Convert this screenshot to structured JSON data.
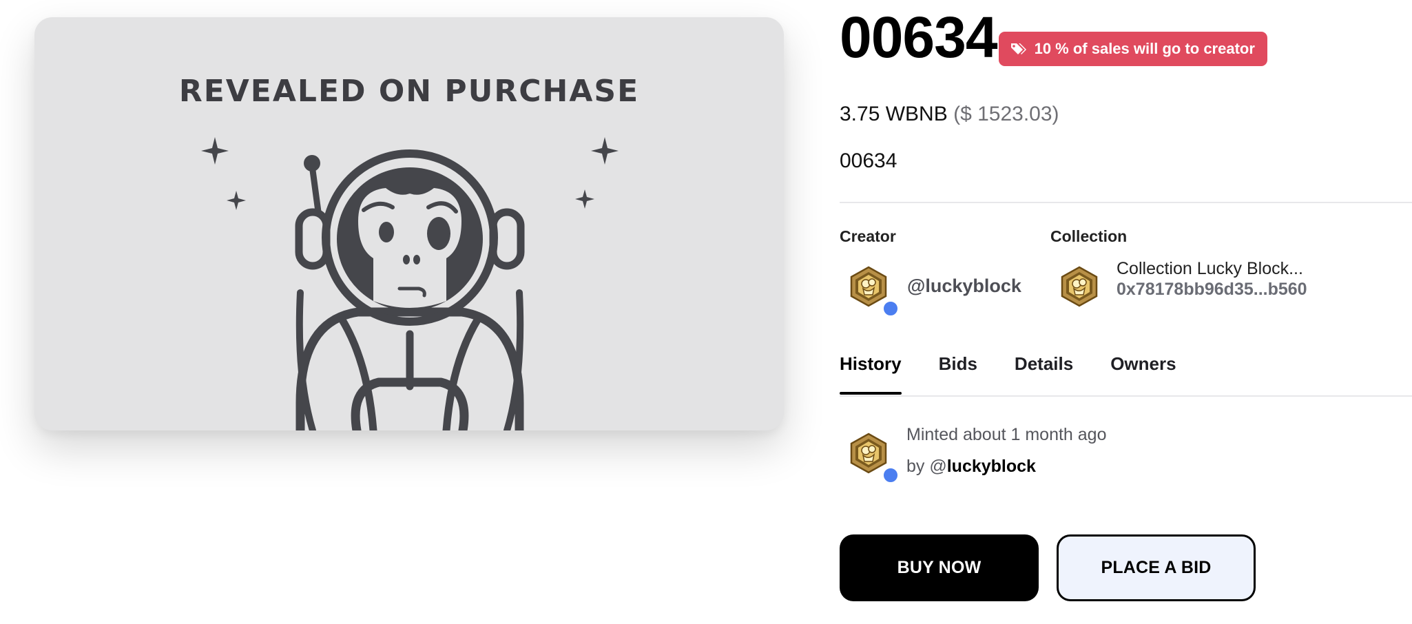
{
  "artwork": {
    "caption": "REVEALED ON PURCHASE",
    "icon": "astronaut-monkey-illustration",
    "colors": {
      "background": "#e3e3e4",
      "ink": "#45464b"
    }
  },
  "item": {
    "title": "00634",
    "royalty_badge": "10 % of sales will go to creator",
    "royalty_icon": "tag-icon",
    "price": "3.75 WBNB",
    "price_usd": "($ 1523.03)",
    "name": "00634"
  },
  "creator": {
    "label": "Creator",
    "handle": "@luckyblock",
    "avatar_icon": "lucky-block-logo-icon",
    "online_indicator_color": "#4b7ef0"
  },
  "collection": {
    "label": "Collection",
    "name": "Collection Lucky Block...",
    "address": "0x78178bb96d35...b560",
    "avatar_icon": "lucky-block-logo-icon"
  },
  "tabs": [
    {
      "label": "History",
      "active": true
    },
    {
      "label": "Bids",
      "active": false
    },
    {
      "label": "Details",
      "active": false
    },
    {
      "label": "Owners",
      "active": false
    }
  ],
  "history": [
    {
      "event": "Minted about 1 month ago",
      "by_prefix": "by @",
      "by_handle": "luckyblock"
    }
  ],
  "actions": {
    "buy_now": "BUY NOW",
    "place_bid": "PLACE A BID"
  },
  "theme": {
    "badge_color": "#e04a5e",
    "primary_button": "#000000",
    "secondary_button": "#eff3fd"
  }
}
